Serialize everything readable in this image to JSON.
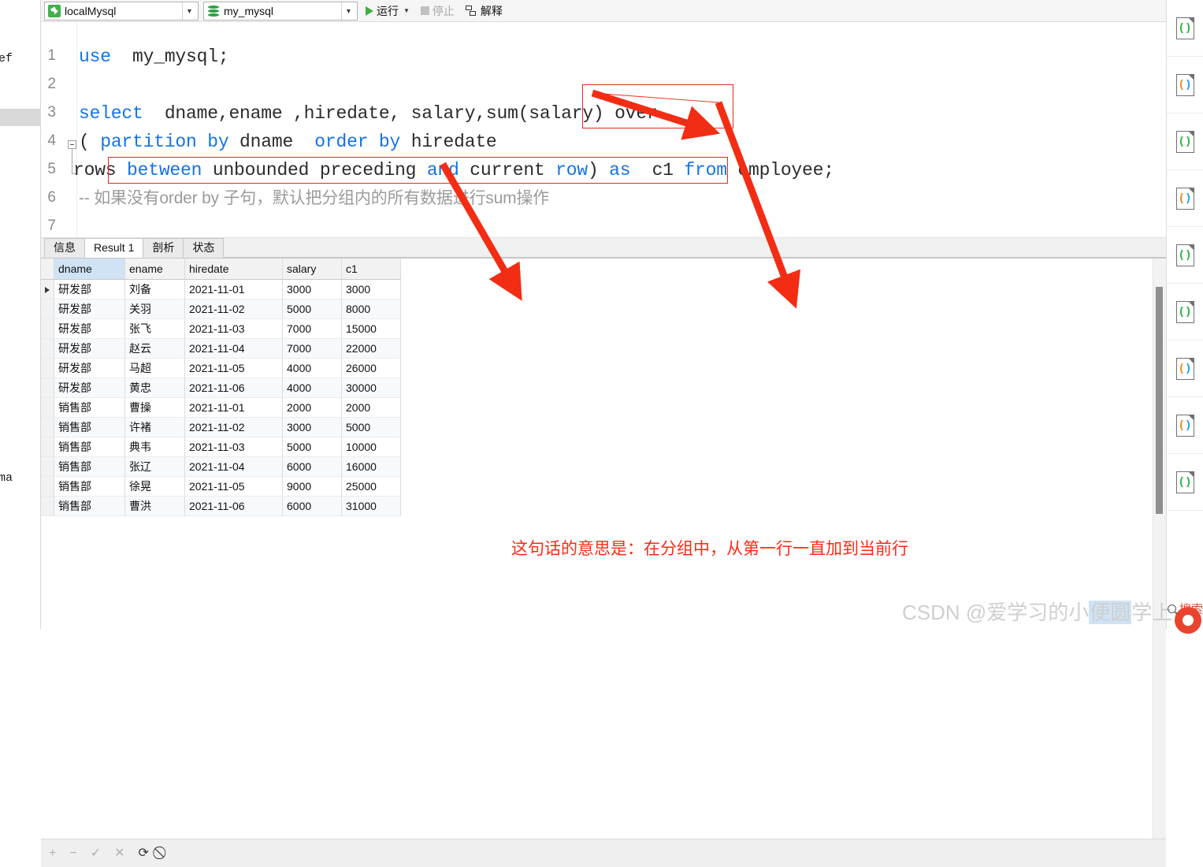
{
  "left_panel": {
    "text_top": "ef",
    "text_bottom": "ma"
  },
  "toolbar": {
    "connection": {
      "label": "localMysql",
      "icon": "mysql-dolphin-icon"
    },
    "database": {
      "label": "my_mysql",
      "icon": "database-icon"
    },
    "run_label": "运行",
    "stop_label": "停止",
    "explain_label": "解释"
  },
  "editor": {
    "lines": [
      {
        "num": "1",
        "segments": [
          {
            "t": "use",
            "c": "kw"
          },
          {
            "t": "  my_mysql;",
            "c": ""
          }
        ]
      },
      {
        "num": "2",
        "segments": []
      },
      {
        "num": "3",
        "segments": [
          {
            "t": "select",
            "c": "kw"
          },
          {
            "t": "  dname,ename ,hiredate, salary,sum(salary) over",
            "c": ""
          }
        ]
      },
      {
        "num": "4",
        "segments": [
          {
            "t": "( ",
            "c": ""
          },
          {
            "t": "partition by",
            "c": "kw"
          },
          {
            "t": " dname  ",
            "c": ""
          },
          {
            "t": "order by",
            "c": "kw"
          },
          {
            "t": " hiredate",
            "c": ""
          }
        ]
      },
      {
        "num": "5",
        "segments": [
          {
            "t": "rows ",
            "c": ""
          },
          {
            "t": "between",
            "c": "kw"
          },
          {
            "t": " unbounded preceding ",
            "c": ""
          },
          {
            "t": "and",
            "c": "kw"
          },
          {
            "t": " current ",
            "c": ""
          },
          {
            "t": "row",
            "c": "kw"
          },
          {
            "t": ") ",
            "c": ""
          },
          {
            "t": "as",
            "c": "kw"
          },
          {
            "t": "  c1 ",
            "c": ""
          },
          {
            "t": "from",
            "c": "kw"
          },
          {
            "t": " employee;",
            "c": ""
          }
        ]
      },
      {
        "num": "6",
        "segments": [
          {
            "t": "-- 如果没有order by 子句，默认把分组内的所有数据进行sum操作",
            "c": "cmt"
          }
        ]
      },
      {
        "num": "7",
        "segments": []
      }
    ]
  },
  "results": {
    "tabs": [
      {
        "label": "信息",
        "active": false
      },
      {
        "label": "Result 1",
        "active": true
      },
      {
        "label": "剖析",
        "active": false
      },
      {
        "label": "状态",
        "active": false
      }
    ],
    "columns": [
      "dname",
      "ename",
      "hiredate",
      "salary",
      "c1"
    ],
    "selected_column": "dname",
    "rows": [
      {
        "marker": true,
        "dname": "研发部",
        "ename": "刘备",
        "hiredate": "2021-11-01",
        "salary": "3000",
        "c1": "3000"
      },
      {
        "marker": false,
        "dname": "研发部",
        "ename": "关羽",
        "hiredate": "2021-11-02",
        "salary": "5000",
        "c1": "8000"
      },
      {
        "marker": false,
        "dname": "研发部",
        "ename": "张飞",
        "hiredate": "2021-11-03",
        "salary": "7000",
        "c1": "15000"
      },
      {
        "marker": false,
        "dname": "研发部",
        "ename": "赵云",
        "hiredate": "2021-11-04",
        "salary": "7000",
        "c1": "22000"
      },
      {
        "marker": false,
        "dname": "研发部",
        "ename": "马超",
        "hiredate": "2021-11-05",
        "salary": "4000",
        "c1": "26000"
      },
      {
        "marker": false,
        "dname": "研发部",
        "ename": "黄忠",
        "hiredate": "2021-11-06",
        "salary": "4000",
        "c1": "30000"
      },
      {
        "marker": false,
        "dname": "销售部",
        "ename": "曹操",
        "hiredate": "2021-11-01",
        "salary": "2000",
        "c1": "2000"
      },
      {
        "marker": false,
        "dname": "销售部",
        "ename": "许褚",
        "hiredate": "2021-11-02",
        "salary": "3000",
        "c1": "5000"
      },
      {
        "marker": false,
        "dname": "销售部",
        "ename": "典韦",
        "hiredate": "2021-11-03",
        "salary": "5000",
        "c1": "10000"
      },
      {
        "marker": false,
        "dname": "销售部",
        "ename": "张辽",
        "hiredate": "2021-11-04",
        "salary": "6000",
        "c1": "16000"
      },
      {
        "marker": false,
        "dname": "销售部",
        "ename": "徐晃",
        "hiredate": "2021-11-05",
        "salary": "9000",
        "c1": "25000"
      },
      {
        "marker": false,
        "dname": "销售部",
        "ename": "曹洪",
        "hiredate": "2021-11-06",
        "salary": "6000",
        "c1": "31000"
      }
    ]
  },
  "annotation": {
    "text": "这句话的意思是：在分组中，从第一行一直加到当前行",
    "color": "#ff2a14"
  },
  "statusbar": {
    "icons": [
      "plus-icon",
      "minus-icon",
      "check-icon",
      "cross-icon",
      "refresh-icon",
      "stop-icon"
    ],
    "glyphs": [
      "+",
      "−",
      "✓",
      "✕",
      "⟳",
      "⃠"
    ]
  },
  "rail": {
    "items": [
      {
        "glyph": "()",
        "color": "green"
      },
      {
        "glyph": "()",
        "color": "orange"
      },
      {
        "glyph": "()",
        "color": "green"
      },
      {
        "glyph": "()",
        "color": "orange"
      },
      {
        "glyph": "()",
        "color": "green"
      },
      {
        "glyph": "()",
        "color": "green"
      },
      {
        "glyph": "()",
        "color": "orange"
      },
      {
        "glyph": "()",
        "color": "orange"
      },
      {
        "glyph": "()",
        "color": "green"
      }
    ]
  },
  "watermark": {
    "prefix": "CSDN @爱学习的小",
    "selected": "便圆",
    "suffix": "学上"
  },
  "taskbar": {
    "search_label": "搜索"
  }
}
